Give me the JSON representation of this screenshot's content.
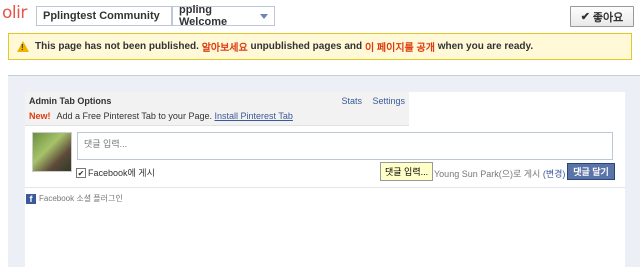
{
  "topbar": {
    "logo": "olir",
    "crumb_community": "Pplingtest Community",
    "crumb_page": "ppling Welcome",
    "like_label": "좋아요"
  },
  "warning": {
    "text_1": "This page has not been published.",
    "link_1": "알아보세요",
    "text_2": "unpublished pages and",
    "link_2": "이 페이지를 공개",
    "text_3": "when you are ready."
  },
  "admin": {
    "title": "Admin Tab Options",
    "stats": "Stats",
    "settings": "Settings",
    "new_label": "New!",
    "promo_text": "Add a Free Pinterest Tab to your Page.",
    "install_link": "Install Pinterest Tab"
  },
  "comment": {
    "placeholder": "댓글 입력...",
    "fb_post_label": "Facebook에 게시",
    "tooltip": "댓글 입력...",
    "post_as": "Young Sun Park(으)로 게시",
    "change": "(변경)",
    "submit": "댓글 달기"
  },
  "footer": {
    "plugin_label": "Facebook 소셜 플러그인"
  },
  "colors": {
    "accent": "#3b5998",
    "warning_bg": "#fff9d7",
    "alert_red": "#dd3c10"
  }
}
